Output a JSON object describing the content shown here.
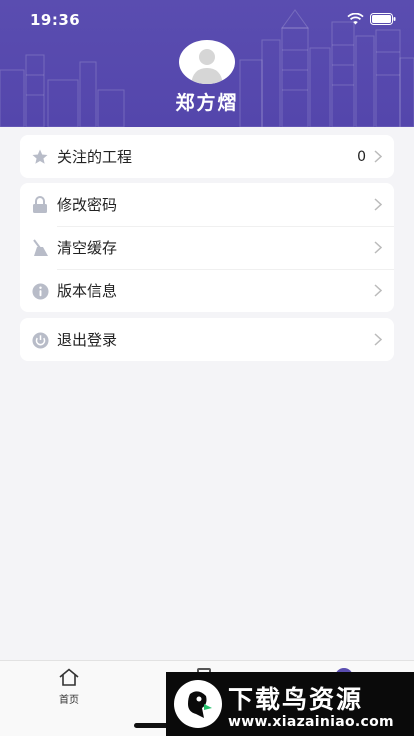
{
  "status_bar": {
    "time": "19:36"
  },
  "profile": {
    "name": "郑方熠"
  },
  "menu_groups": [
    {
      "items": [
        {
          "label": "关注的工程",
          "value": "0",
          "icon": "star-icon"
        }
      ]
    },
    {
      "items": [
        {
          "label": "修改密码",
          "icon": "lock-icon"
        },
        {
          "label": "清空缓存",
          "icon": "broom-icon"
        },
        {
          "label": "版本信息",
          "icon": "info-icon"
        }
      ]
    },
    {
      "items": [
        {
          "label": "退出登录",
          "icon": "power-icon"
        }
      ]
    }
  ],
  "tabbar": {
    "home_label": "首页"
  },
  "watermark": {
    "title": "下载鸟资源",
    "url": "www.xiazainiao.com"
  },
  "colors": {
    "header": "#5a4db0",
    "background": "#f4f4f7",
    "icon_gray": "#b8bcc8"
  }
}
